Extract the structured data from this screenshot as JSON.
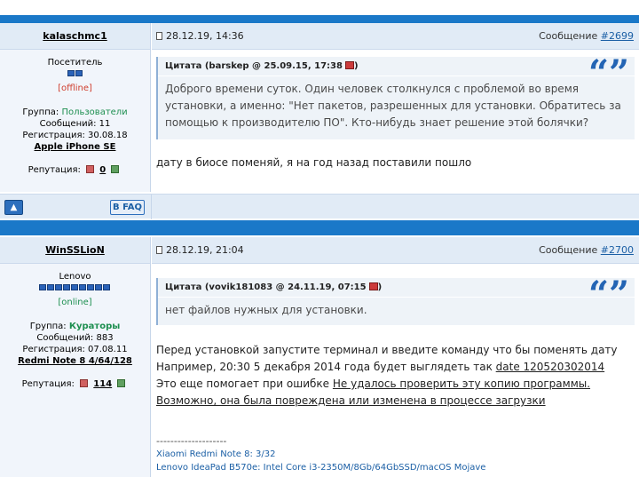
{
  "posts": [
    {
      "author": "kalaschmc1",
      "rank": "Посетитель",
      "rank_pips": 2,
      "status": "[offline]",
      "group_label": "Группа:",
      "group": "Пользователи",
      "messages": "Сообщений: 11",
      "registered": "Регистрация: 30.08.18",
      "device": "Apple iPhone SE",
      "reputation_label": "Репутация:",
      "reputation": "0",
      "date": "28.12.19, 14:36",
      "message_label": "Сообщение",
      "message_number": "#2699",
      "quote_header": "Цитата (barskep @ 25.09.15, 17:38",
      "quote_text": "Доброго времени суток. Один человек столкнулся с проблемой во время установки, а именно: \"Нет пакетов, разрешенных для установки. Обратитесь за помощью к производителю ПО\". Кто-нибудь знает решение этой болячки?",
      "body": "дату в биосе поменяй, я на год назад поставили пошло"
    },
    {
      "author": "WinSSLioN",
      "rank": "Lenovo",
      "rank_pips": 9,
      "status": "[online]",
      "group_label": "Группа:",
      "group": "Кураторы",
      "messages": "Сообщений: 883",
      "registered": "Регистрация: 07.08.11",
      "device": "Redmi Note 8 4/64/128",
      "reputation_label": "Репутация:",
      "reputation": "114",
      "date": "28.12.19, 21:04",
      "message_label": "Сообщение",
      "message_number": "#2700",
      "quote_header": "Цитата (vovik181083 @ 24.11.19, 07:15",
      "quote_text": "нет файлов нужных для установки.",
      "body_line1": "Перед установкой запустите терминал и введите команду что бы поменять дату",
      "body_line2_prefix": "Например, 20:30 5 декабря 2014 года будет выглядеть так ",
      "body_line2_link": "date 120520302014",
      "body_line3_prefix": "Это еще помогает при ошибке ",
      "body_line3_link": "Не удалось проверить эту копию программы.",
      "body_line4_link": "Возможно, она была повреждена или изменена в процессе загрузки",
      "sig_rule": "--------------------",
      "sig_line1": "Xiaomi Redmi Note 8: 3/32",
      "sig_line2": "Lenovo IdeaPad B570e: Intel Core i3-2350M/8Gb/64GbSSD/macOS Mojave"
    }
  ],
  "footer": {
    "up_icon": "up-arrow-icon",
    "faq_label": "B FAQ"
  },
  "colors": {
    "separator": "#1a78c8",
    "header_bg": "#e1ebf6",
    "sidebar_bg": "#f1f5fb",
    "link": "#1b5fa5",
    "quote_mark": "#2364b4"
  }
}
